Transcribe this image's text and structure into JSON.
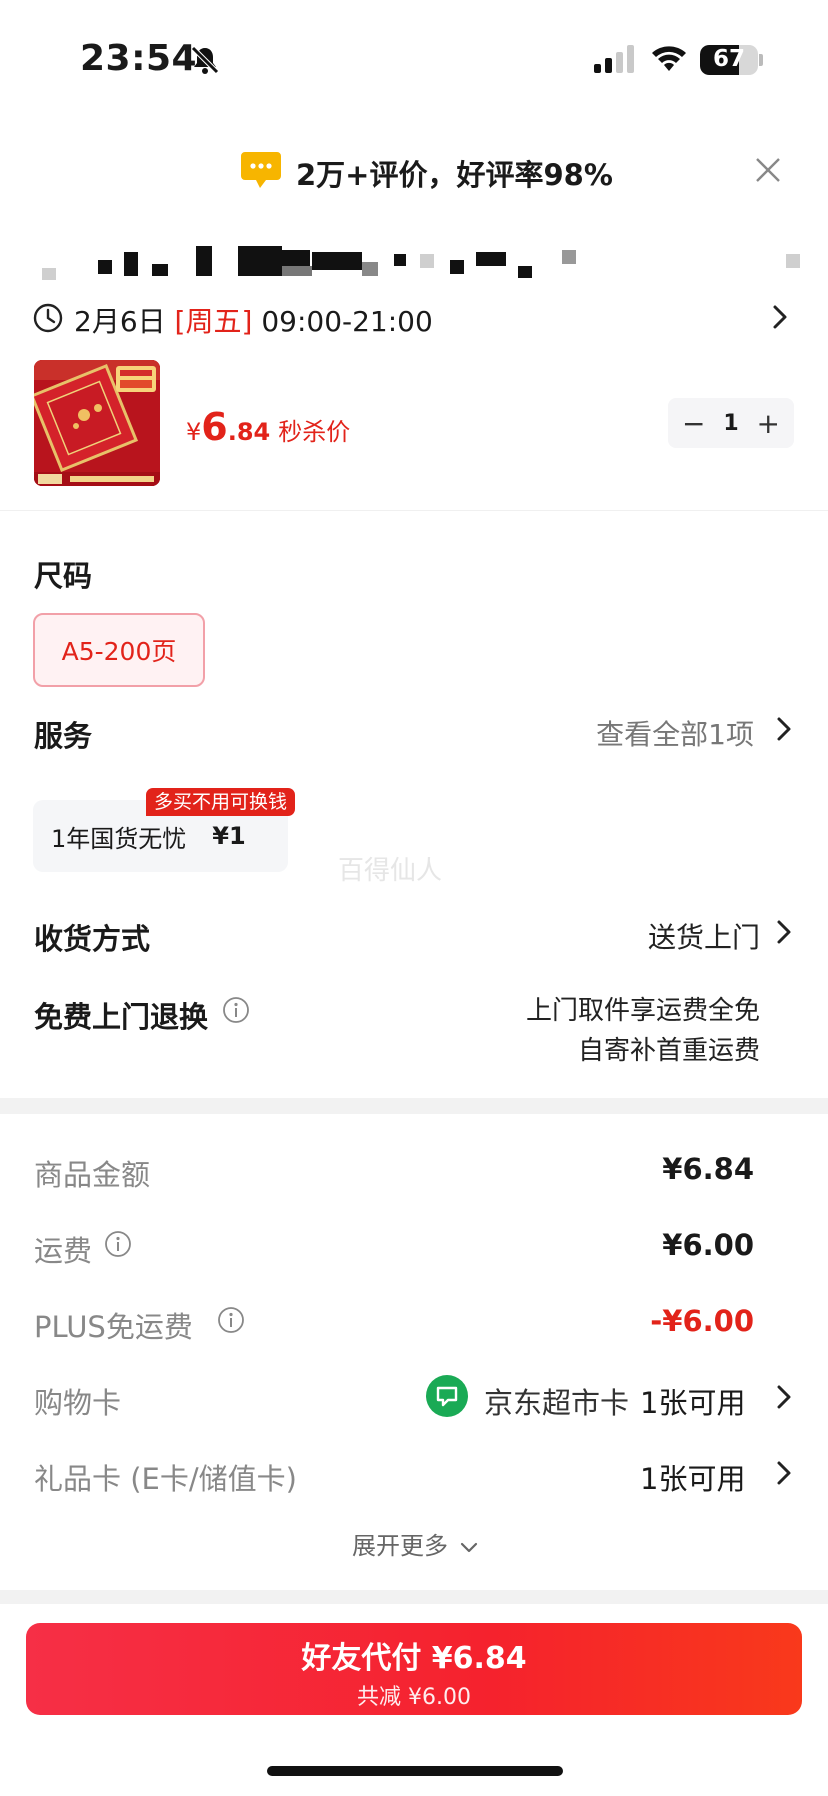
{
  "status_bar": {
    "time": "23:54",
    "battery": "67",
    "battery_level": 0.67
  },
  "review_banner": {
    "text": "2万+评价，好评率98%"
  },
  "delivery": {
    "date": "2月6日",
    "weekday": "[周五]",
    "hours": "09:00-21:00"
  },
  "product": {
    "price_symbol": "¥",
    "price_int": "6",
    "price_dec": ".84",
    "price_label": "秒杀价",
    "quantity": "1",
    "minus": "−",
    "plus": "+"
  },
  "size": {
    "title": "尺码",
    "selected": "A5-200页"
  },
  "service": {
    "title": "服务",
    "view_all": "查看全部1项",
    "card_name": "1年国货无忧",
    "card_price": "¥1",
    "tag": "多买不用可换钱"
  },
  "watermark": "百得仙人",
  "shipping": {
    "label": "收货方式",
    "value": "送货上门"
  },
  "free_return": {
    "label": "免费上门退换",
    "line1": "上门取件享运费全免",
    "line2": "自寄补首重运费"
  },
  "summary": {
    "goods_label": "商品金额",
    "goods_value": "¥6.84",
    "freight_label": "运费",
    "freight_value": "¥6.00",
    "plus_label": "PLUS免运费",
    "plus_value": "-¥6.00",
    "shopcard_label": "购物卡",
    "shopcard_name": "京东超市卡",
    "shopcard_avail": "1张可用",
    "giftcard_label": "礼品卡 (E卡/储值卡)",
    "giftcard_avail": "1张可用",
    "expand": "展开更多"
  },
  "pay_button": {
    "main": "好友代付 ¥6.84",
    "sub": "共减 ¥6.00"
  },
  "colors": {
    "accent": "#e2231a",
    "card_green": "#1aaa55"
  }
}
